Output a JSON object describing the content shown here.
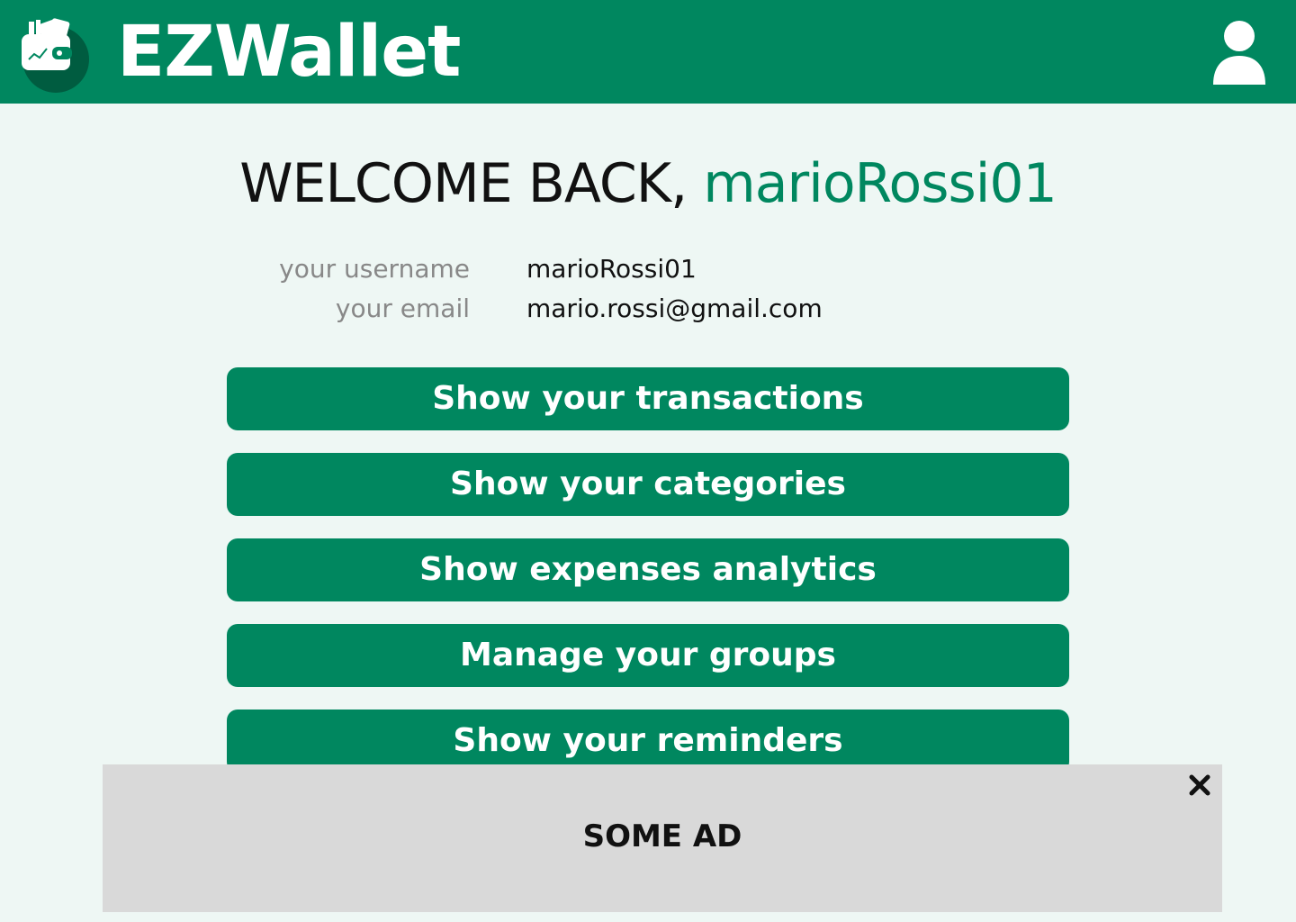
{
  "header": {
    "app_name": "EZWallet",
    "logo_icon": "wallet-logo-icon",
    "profile_icon": "user-profile-icon"
  },
  "welcome": {
    "prefix": "WELCOME BACK, ",
    "username": "marioRossi01"
  },
  "info": {
    "username_label": "your username",
    "username_value": "marioRossi01",
    "email_label": "your email",
    "email_value": "mario.rossi@gmail.com"
  },
  "actions": [
    {
      "label": "Show your transactions"
    },
    {
      "label": "Show your categories"
    },
    {
      "label": "Show expenses analytics"
    },
    {
      "label": "Manage your groups"
    },
    {
      "label": "Show your reminders"
    }
  ],
  "ad": {
    "text": "SOME AD",
    "close_icon": "close-icon"
  },
  "colors": {
    "brand": "#00875f",
    "background": "#eef7f4",
    "ad_background": "#d9d9d9"
  }
}
